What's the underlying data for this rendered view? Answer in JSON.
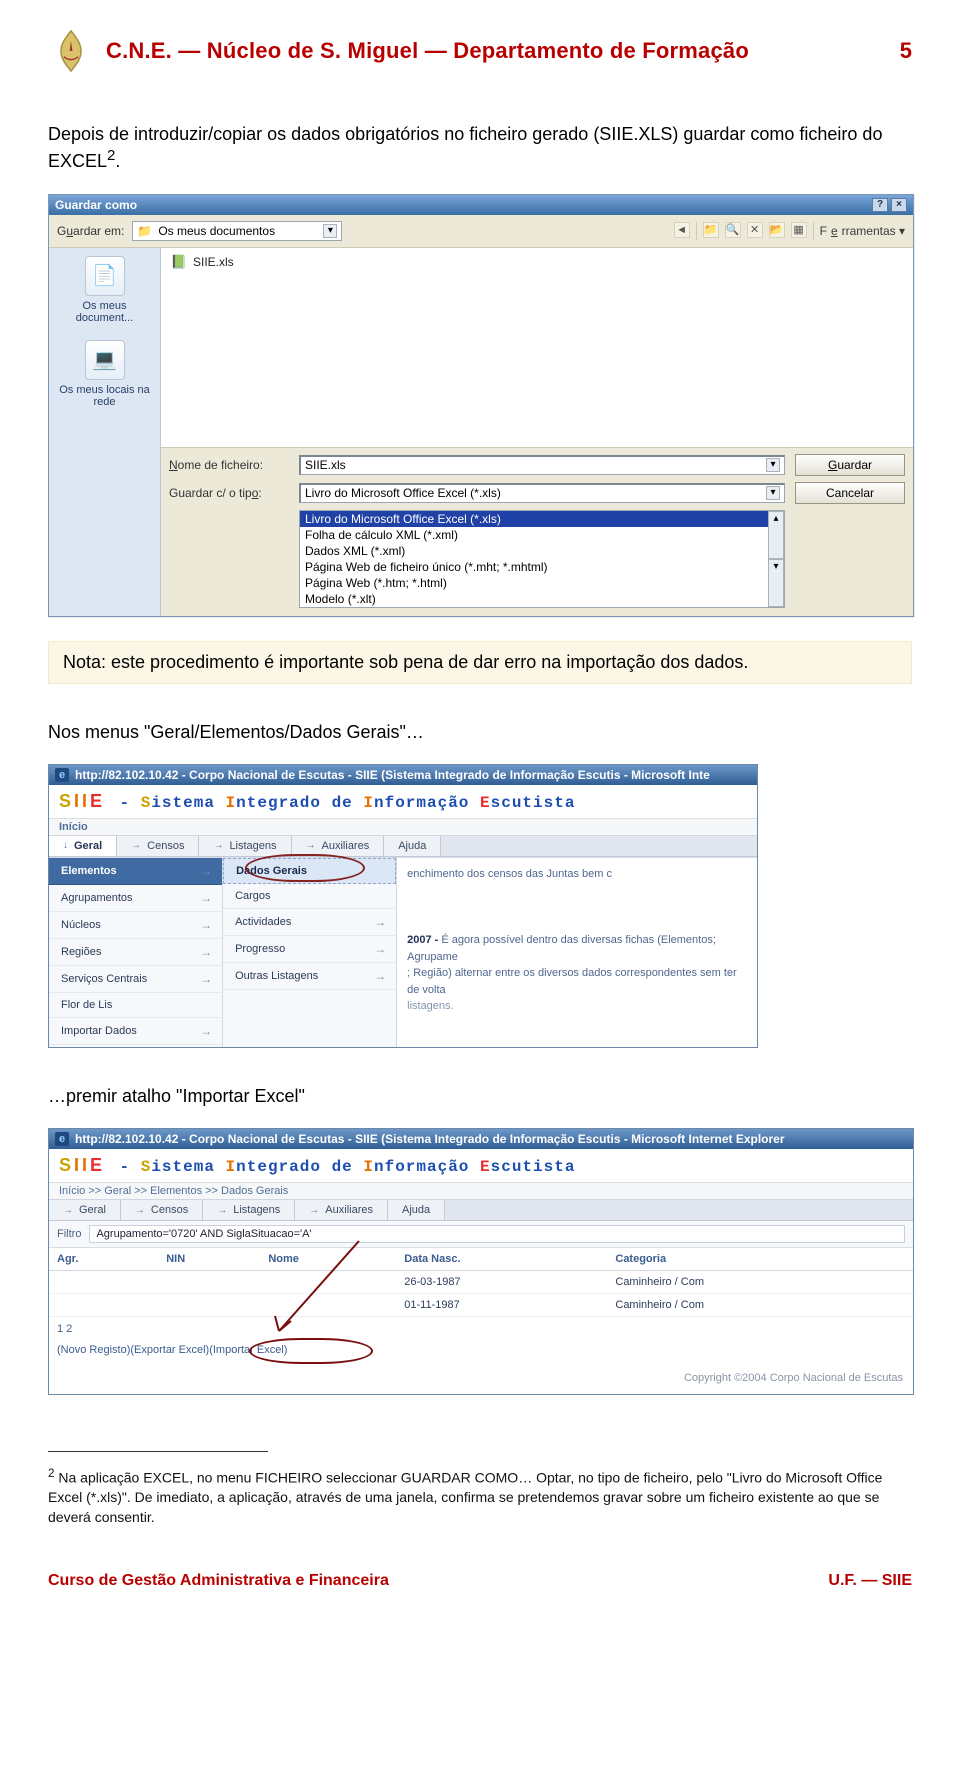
{
  "header": {
    "title": "C.N.E. — Núcleo de S. Miguel — Departamento de Formação",
    "page_number": "5"
  },
  "intro": {
    "line": "Depois de introduzir/copiar os dados obrigatórios no ficheiro gerado (SIIE.XLS) guardar como ficheiro do EXCEL",
    "sup": "2",
    "tail": "."
  },
  "save_dialog": {
    "title": "Guardar como",
    "loc_label_pre": "G",
    "loc_label_acc": "u",
    "loc_label_post": "ardar em:",
    "folder_icon": "📁",
    "location_value": "Os meus documentos",
    "tools_label_pre": "F",
    "tools_label_acc": "e",
    "tools_label_post": "rramentas ▾",
    "places": [
      {
        "label": "Os meus document..."
      },
      {
        "label": "Os meus locais na rede"
      }
    ],
    "file_list_item": "SIIE.xls",
    "filename_label_pre": "",
    "filename_label_acc": "N",
    "filename_label_post": "ome de ficheiro:",
    "filename_value": "SIIE.xls",
    "type_label_pre": "Guardar c/ o tip",
    "type_label_acc": "o",
    "type_label_post": ":",
    "type_value": "Livro do Microsoft Office Excel (*.xls)",
    "type_options": [
      "Livro do Microsoft Office Excel (*.xls)",
      "Folha de cálculo XML (*.xml)",
      "Dados XML (*.xml)",
      "Página Web de ficheiro único (*.mht; *.mhtml)",
      "Página Web (*.htm; *.html)",
      "Modelo (*.xlt)"
    ],
    "save_btn_pre": "",
    "save_btn_acc": "G",
    "save_btn_post": "uardar",
    "cancel_btn": "Cancelar"
  },
  "note": {
    "bold": "Nota:",
    "text": " este procedimento é importante sob pena de dar erro na importação dos dados."
  },
  "para_menus": "Nos menus \"Geral/Elementos/Dados Gerais\"…",
  "siie1": {
    "ie_title": "http://82.102.10.42 - Corpo Nacional de Escutas - SIIE (Sistema Integrado de Informação Escutis - Microsoft Inte",
    "tag": "Sistema Integrado de Informação Escutista",
    "breadcrumb": "Início",
    "tabs": [
      "Geral",
      "Censos",
      "Listagens",
      "Auxiliares",
      "Ajuda"
    ],
    "menu1": [
      "Elementos",
      "Agrupamentos",
      "Núcleos",
      "Regiões",
      "Serviços Centrais",
      "Flor de Lis",
      "Importar Dados"
    ],
    "menu2": [
      "Dados Gerais",
      "Cargos",
      "Actividades",
      "Progresso",
      "Outras Listagens"
    ],
    "news1": "enchimento dos censos das Juntas bem c",
    "news2_pre": "2007 - ",
    "news2": "É agora possível dentro das diversas fichas (Elementos; Agrupame",
    "news3": "; Região) alternar entre os diversos dados correspondentes sem ter de volta",
    "news4": "listagens."
  },
  "para_importar": "…premir atalho \"Importar Excel\"",
  "siie2": {
    "ie_title": "http://82.102.10.42 - Corpo Nacional de Escutas - SIIE (Sistema Integrado de Informação Escutis - Microsoft Internet Explorer",
    "tag": "Sistema Integrado de Informação Escutista",
    "breadcrumb": "Início >> Geral >> Elementos >> Dados Gerais",
    "tabs": [
      "Geral",
      "Censos",
      "Listagens",
      "Auxiliares",
      "Ajuda"
    ],
    "filter_label": "Filtro",
    "filter_value": "Agrupamento='0720' AND SiglaSituacao='A'",
    "columns": [
      "Agr.",
      "NIN",
      "Nome",
      "Data Nasc.",
      "Categoria"
    ],
    "rows": [
      {
        "agr": "",
        "nin": "",
        "nome": "",
        "data": "26-03-1987",
        "cat": "Caminheiro / Com"
      },
      {
        "agr": "",
        "nin": "",
        "nome": "",
        "data": "01-11-1987",
        "cat": "Caminheiro / Com"
      }
    ],
    "pager": "1 2",
    "actions": "(Novo Registo)(Exportar Excel)(Importar Excel)",
    "copyright": "Copyright ©2004 Corpo Nacional de Escutas"
  },
  "footnote": {
    "sup": "2",
    "text": " Na aplicação EXCEL, no menu FICHEIRO seleccionar GUARDAR COMO… Optar, no tipo de ficheiro, pelo \"Livro do Microsoft Office Excel (*.xls)\". De imediato, a aplicação, através de uma janela, confirma se pretendemos gravar sobre um ficheiro existente ao que se deverá consentir."
  },
  "footer": {
    "left": "Curso de Gestão Administrativa e Financeira",
    "right": "U.F. — SIIE"
  }
}
